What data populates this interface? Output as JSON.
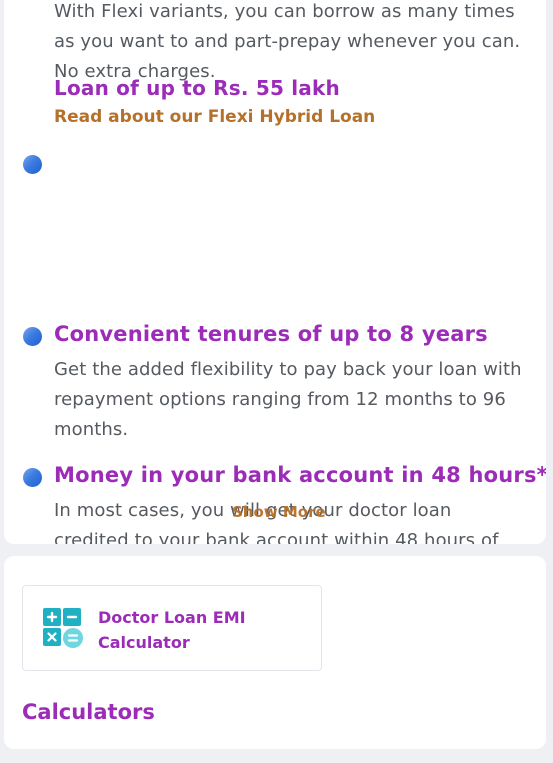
{
  "intro": {
    "text": "With Flexi variants, you can borrow as many times as you want to and part-prepay whenever you can. No extra charges."
  },
  "loan": {
    "title": "Loan of up to Rs. 55 lakh",
    "link_label": "Read about our Flexi Hybrid Loan"
  },
  "features": [
    {
      "title": "Convenient tenures of up to 8 years",
      "body": "Get the added flexibility to pay back your loan with repayment options ranging from 12 months to 96 months."
    },
    {
      "title": "Money in your bank account in 48 hours*",
      "body": "In most cases, you will get your doctor loan credited to your bank account within 48 hours of"
    }
  ],
  "show_more_label": "Show More",
  "calculators": {
    "tile_label": "Doctor Loan EMI Calculator",
    "heading": "Calculators",
    "icon": "calculator-icon"
  },
  "colors": {
    "accent_purple": "#9c2cb8",
    "link_brown": "#b5702a",
    "bullet_blue": "#3d7be0",
    "icon_teal": "#1fb0c4"
  }
}
